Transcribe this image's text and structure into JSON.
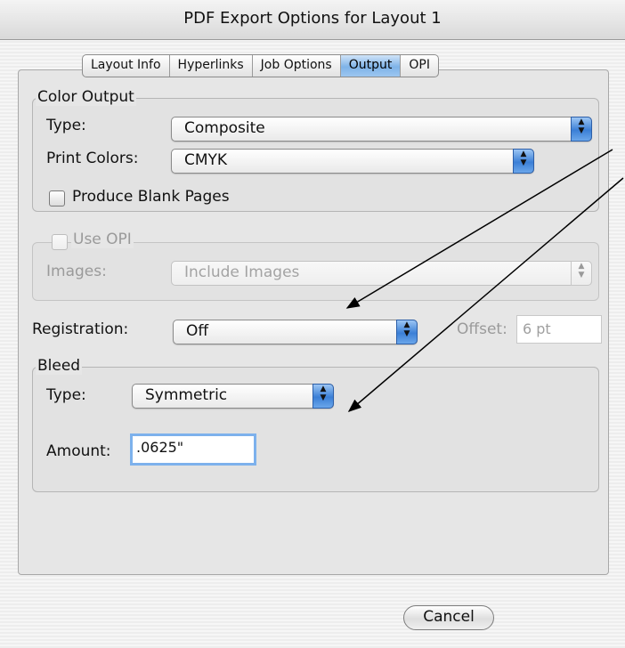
{
  "window": {
    "title": "PDF Export Options for Layout 1"
  },
  "tabs": [
    {
      "label": "Layout Info",
      "active": false
    },
    {
      "label": "Hyperlinks",
      "active": false
    },
    {
      "label": "Job Options",
      "active": false
    },
    {
      "label": "Output",
      "active": true
    },
    {
      "label": "OPI",
      "active": false
    }
  ],
  "color_output": {
    "legend": "Color Output",
    "type_label": "Type:",
    "type_value": "Composite",
    "print_colors_label": "Print Colors:",
    "print_colors_value": "CMYK",
    "blank_pages_label": "Produce Blank Pages",
    "blank_pages_checked": false
  },
  "opi": {
    "legend": "Use OPI",
    "enabled": false,
    "images_label": "Images:",
    "images_value": "Include Images"
  },
  "registration": {
    "label": "Registration:",
    "value": "Off",
    "offset_label": "Offset:",
    "offset_value": "6 pt"
  },
  "bleed": {
    "legend": "Bleed",
    "type_label": "Type:",
    "type_value": "Symmetric",
    "amount_label": "Amount:",
    "amount_value": ".0625\""
  },
  "buttons": {
    "cancel": "Cancel"
  },
  "colors": {
    "accent": "#3b7fd6",
    "focus_ring": "#7db1ec"
  }
}
